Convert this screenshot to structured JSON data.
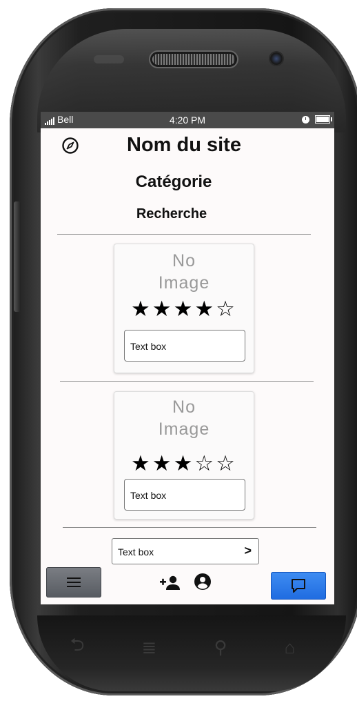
{
  "status_bar": {
    "carrier": "Bell",
    "time": "4:20 PM"
  },
  "header": {
    "title": "Nom du site",
    "category": "Catégorie",
    "search": "Recherche"
  },
  "cards": [
    {
      "image_placeholder_line1": "No",
      "image_placeholder_line2": "Image",
      "rating_display": "★★★★☆",
      "rating": 4,
      "rating_max": 5,
      "text_box": "Text box"
    },
    {
      "image_placeholder_line1": "No",
      "image_placeholder_line2": "Image",
      "rating_display": "★★★☆☆",
      "rating": 3,
      "rating_max": 5,
      "text_box": "Text box"
    }
  ],
  "bottom_input": {
    "value": "Text box"
  },
  "icons": {
    "compass": "compass-icon",
    "menu": "hamburger-menu-icon",
    "add_user": "add-user-icon",
    "account": "account-circle-icon",
    "chat": "chat-bubble-icon",
    "chevron": "chevron-right-icon"
  },
  "colors": {
    "chat_button": "#2b7ae8",
    "menu_button": "#6b6e74",
    "status_bar": "#4a4a4a"
  }
}
